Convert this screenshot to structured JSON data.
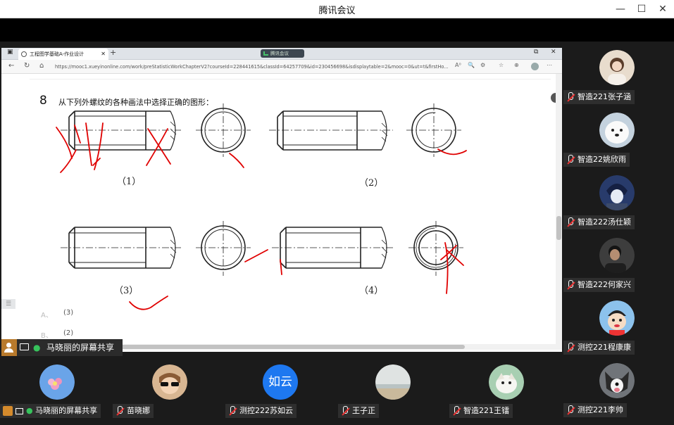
{
  "window": {
    "title": "腾讯会议",
    "minimize": "—",
    "maximize": "☐",
    "close": "✕"
  },
  "browser": {
    "tab_title": "工程图学基础A-作业设计",
    "new_tab": "+",
    "meeting_indicator": "腾讯会议",
    "url": "https://mooc1.xueyinonline.com/work/preStatisticWorkChapterV2?courseId=228441615&classId=64257709&id=230456698&isdisplaytable=2&mooc=0&ut=t&firstHo...",
    "addr_tools": [
      "A⁰",
      "🔍",
      "⚙",
      "☆",
      "⊕"
    ]
  },
  "page": {
    "question_number": "8",
    "question_text": "从下列外螺纹的各种画法中选择正确的图形：",
    "figure_labels": [
      "（1）",
      "（2）",
      "（3）",
      "（4）"
    ],
    "options": [
      {
        "letter": "A、",
        "value": "(3)"
      },
      {
        "letter": "B、",
        "value": "(2)"
      }
    ],
    "side_button": "☰",
    "collapse_button": "‹"
  },
  "sharer": {
    "name": "马晓丽的屏幕共享"
  },
  "right_participants": [
    {
      "name": "智造221张子涵",
      "color": "#d9c2a8",
      "icon": "girl-photo"
    },
    {
      "name": "智造22姚欣雨",
      "color": "#b9c7d6",
      "icon": "white-dog"
    },
    {
      "name": "智造222汤仕颖",
      "color": "#2e3f6e",
      "icon": "anime-boy"
    },
    {
      "name": "智造222何家兴",
      "color": "#3a3a3a",
      "icon": "man-photo"
    },
    {
      "name": "测控221程康康",
      "color": "#79b6e6",
      "icon": "crayon-shinchan"
    },
    {
      "name": "测控221李帅",
      "color": "#6b6f74",
      "icon": "husky-dog"
    }
  ],
  "bottom_participants": [
    {
      "name": "马晓丽的屏幕共享",
      "color": "#6fa7e6",
      "avatar_text": "",
      "icon": "flower-photo",
      "host": true
    },
    {
      "name": "苗晓娜",
      "color": "#c8a07c",
      "avatar_text": "",
      "icon": "kid-sunglasses"
    },
    {
      "name": "测控222苏如云",
      "color": "#1e78f0",
      "avatar_text": "如云",
      "icon": ""
    },
    {
      "name": "王子正",
      "color": "#c9cfcf",
      "avatar_text": "",
      "icon": "beach-photo"
    },
    {
      "name": "智造221王镭",
      "color": "#9dc6a8",
      "avatar_text": "",
      "icon": "dog-photo"
    }
  ]
}
